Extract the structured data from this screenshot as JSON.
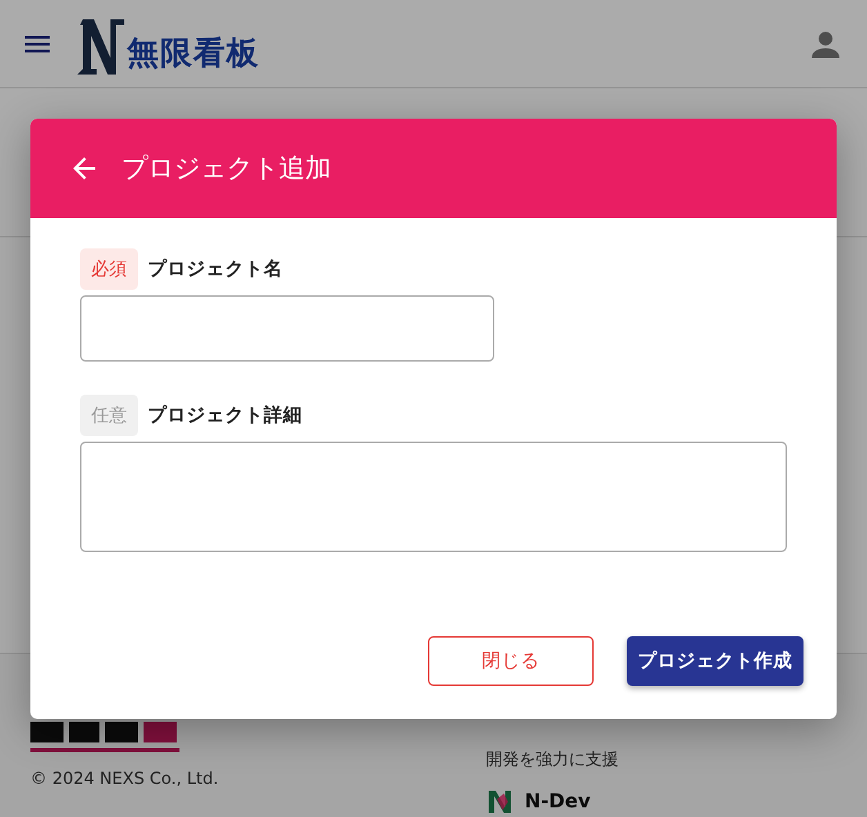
{
  "header": {
    "logo_text": "無限看板"
  },
  "footer": {
    "copyright": "© 2024 NEXS Co., Ltd.",
    "tagline": "開発を強力に支援",
    "partner": "N-Dev"
  },
  "dialog": {
    "title": "プロジェクト追加",
    "fields": [
      {
        "tag": "必須",
        "kind": "required",
        "label": "プロジェクト名",
        "multiline": false
      },
      {
        "tag": "任意",
        "kind": "optional",
        "label": "プロジェクト詳細",
        "multiline": true
      }
    ],
    "buttons": [
      {
        "label": "閉じる",
        "kind": "outline"
      },
      {
        "label": "プロジェクト作成",
        "kind": "primary"
      }
    ]
  }
}
